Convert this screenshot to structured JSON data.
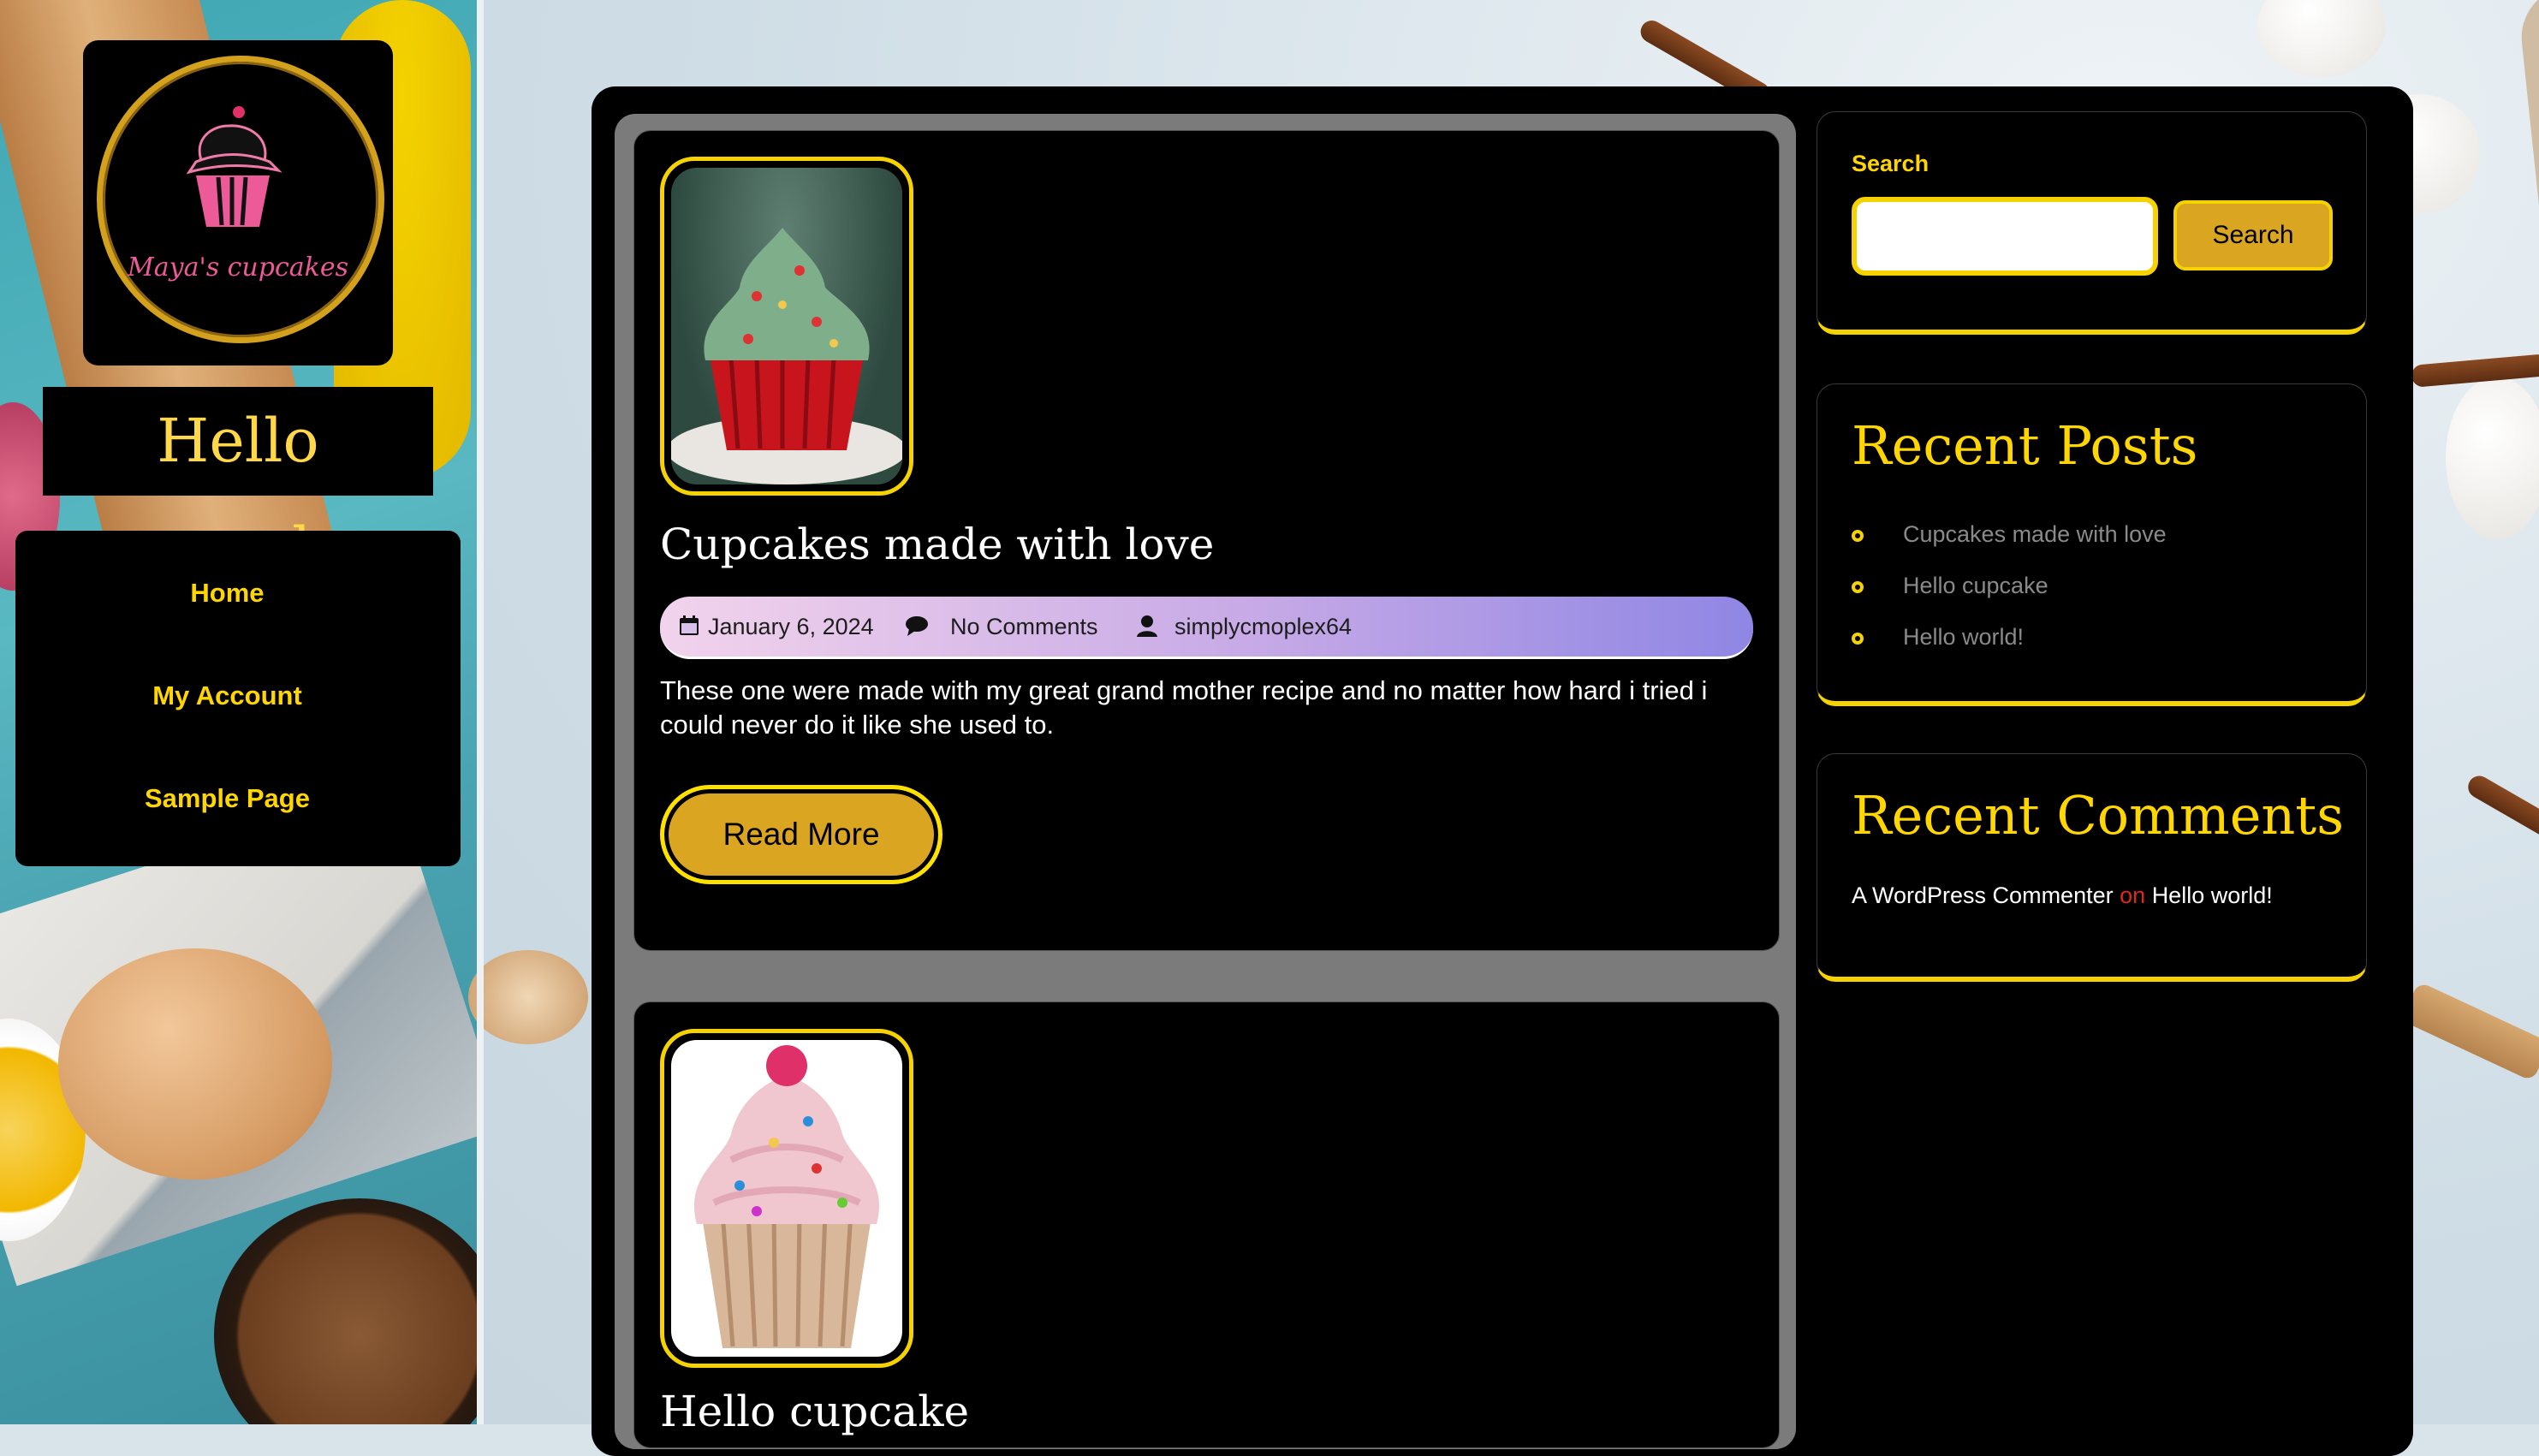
{
  "site": {
    "logo_text": "Maya's cupcakes",
    "title": "Hello cupcake"
  },
  "nav": {
    "items": [
      {
        "label": "Home"
      },
      {
        "label": "My Account"
      },
      {
        "label": "Sample Page"
      }
    ]
  },
  "posts": [
    {
      "title": "Cupcakes made with love",
      "date": "January 6, 2024",
      "comments": "No Comments",
      "author": "simplycmoplex64",
      "excerpt": "These one were made with my great grand mother recipe and no matter how hard i tried i could never do it like she used to.",
      "read_more": "Read More"
    },
    {
      "title": "Hello cupcake"
    }
  ],
  "sidebar": {
    "search": {
      "label": "Search",
      "button": "Search",
      "placeholder": ""
    },
    "recent_posts": {
      "title": "Recent Posts",
      "items": [
        "Cupcakes made with love",
        "Hello cupcake",
        "Hello world!"
      ]
    },
    "recent_comments": {
      "title": "Recent Comments",
      "author": "A WordPress Commenter",
      "on": "on",
      "post": "Hello world!"
    }
  },
  "colors": {
    "accent": "#f5d200",
    "button": "#daa520",
    "panel": "#000000"
  }
}
